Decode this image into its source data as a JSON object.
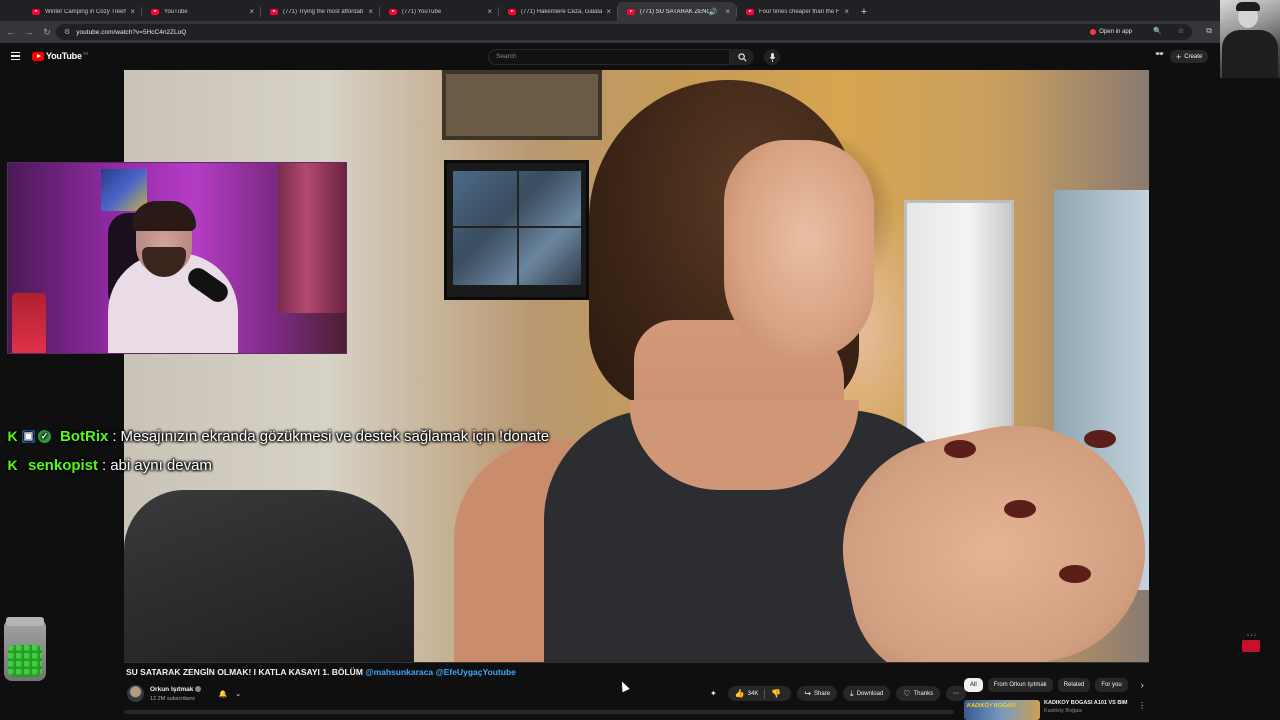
{
  "browser": {
    "tabs": [
      {
        "title": "Winter Camping in Cozy Treeho",
        "active": false
      },
      {
        "title": "YouTube",
        "active": false
      },
      {
        "title": "(771) Trying the most affordab",
        "active": false
      },
      {
        "title": "(771) YouTube",
        "active": false
      },
      {
        "title": "(771) Hakemlere Ceza, Galatasa",
        "active": false
      },
      {
        "title": "(771) SU SATARAK ZENGİN",
        "active": true
      },
      {
        "title": "Four times cheaper than the F",
        "active": false
      }
    ],
    "new_tab_symbol": "+",
    "close_symbol": "×",
    "url": "youtube.com/watch?v=5HcC4n2ZLoQ",
    "open_in_app_label": "Open in app"
  },
  "youtube": {
    "logo_text": "YouTube",
    "logo_country": "TR",
    "search_placeholder": "Search",
    "create_label": "Create"
  },
  "chat": [
    {
      "badges": [
        "kick-icon",
        "bot-badge-icon",
        "verified-badge-icon"
      ],
      "username": "BotRix",
      "separator": ":",
      "message": "Mesajınızın ekranda gözükmesi ve destek sağlamak için !donate"
    },
    {
      "badges": [
        "kick-icon"
      ],
      "username": "senkopist",
      "separator": ":",
      "message": "abi aynı devam"
    }
  ],
  "video": {
    "title_plain": "SU SATARAK ZENGİN OLMAK! I KATLA KASAYI 1. BÖLÜM",
    "title_links": "@mahsunkaraca @EfeUygaçYoutube",
    "channel_name": "Orkun Işıtmak",
    "subscribers": "12.2M subscribers",
    "like_count": "34K",
    "share_label": "Share",
    "download_label": "Download",
    "thanks_label": "Thanks",
    "more_label": "⋯"
  },
  "chips": [
    {
      "label": "All",
      "selected": true
    },
    {
      "label": "From Orkun Işıtmak",
      "selected": false
    },
    {
      "label": "Related",
      "selected": false
    },
    {
      "label": "For you",
      "selected": false
    }
  ],
  "recommended": {
    "thumb_text": "KADIKÖY BOĞASI",
    "title": "KADIKÖY BOĞASI A101 VS BİM",
    "channel": "Kadıköy Boğası"
  },
  "widget": {
    "top_text": "↓↓↓"
  },
  "colors": {
    "youtube_red": "#ff0000",
    "kick_green": "#53fc18",
    "link_blue": "#3ea6ff",
    "page_bg": "#0f0f0f"
  }
}
